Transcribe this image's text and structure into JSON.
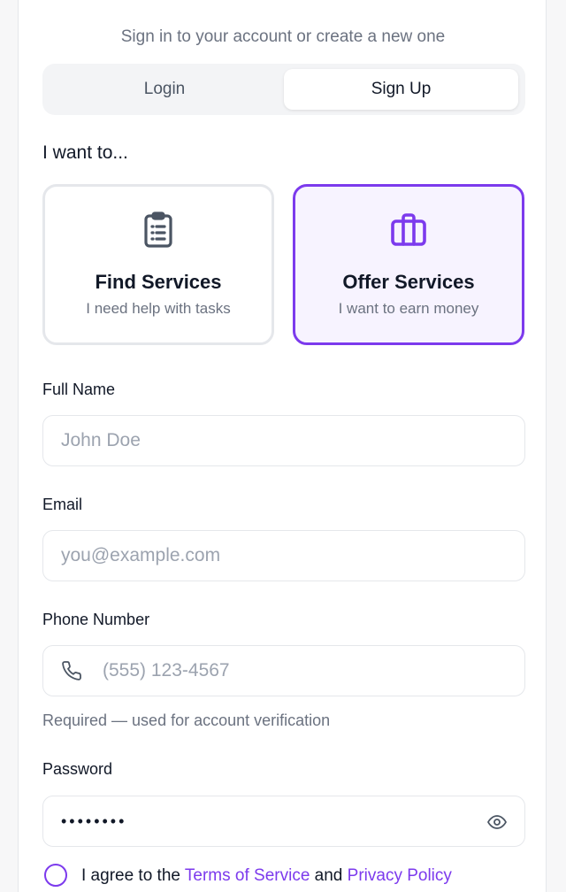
{
  "header": {
    "subtitle": "Sign in to your account or create a new one"
  },
  "tabs": {
    "login": "Login",
    "signup": "Sign Up",
    "active": "signup"
  },
  "role": {
    "heading": "I want to...",
    "options": [
      {
        "title": "Find Services",
        "description": "I need help with tasks",
        "icon": "clipboard-list-icon",
        "selected": false
      },
      {
        "title": "Offer Services",
        "description": "I want to earn money",
        "icon": "briefcase-icon",
        "selected": true
      }
    ]
  },
  "form": {
    "full_name": {
      "label": "Full Name",
      "placeholder": "John Doe",
      "value": ""
    },
    "email": {
      "label": "Email",
      "placeholder": "you@example.com",
      "value": ""
    },
    "phone": {
      "label": "Phone Number",
      "placeholder": "(555) 123-4567",
      "value": "",
      "icon": "phone-icon",
      "helper": "Required — used for account verification"
    },
    "password": {
      "label": "Password",
      "value": "••••••••",
      "icon": "eye-icon"
    }
  },
  "terms": {
    "prefix": "I agree to the",
    "tos_link": "Terms of Service",
    "and": "and",
    "privacy_link": "Privacy Policy"
  },
  "colors": {
    "accent": "#7c3aed",
    "accent_bg": "#f7f3ff",
    "border": "#e5e7eb",
    "muted_text": "#6b7280",
    "placeholder": "#9ca3af"
  }
}
